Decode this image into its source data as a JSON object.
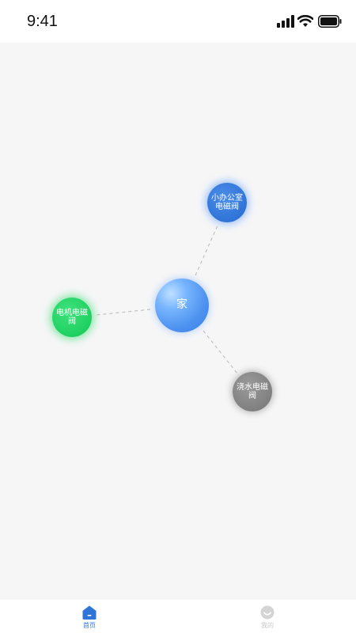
{
  "status_bar": {
    "time": "9:41"
  },
  "graph": {
    "center": {
      "label": "家"
    },
    "nodes": {
      "office": {
        "label": "小办公室电磁阀",
        "color": "#2f74d7"
      },
      "motor": {
        "label": "电机电磁阀",
        "color": "#1fd061"
      },
      "water": {
        "label": "浇水电磁阀",
        "color": "#808080"
      }
    },
    "link_color": "#b7b7b7"
  },
  "tab_bar": {
    "home_label": "首页",
    "mine_label": "我的",
    "active_color": "#2f74d7",
    "inactive_color": "#c8c8c8"
  }
}
